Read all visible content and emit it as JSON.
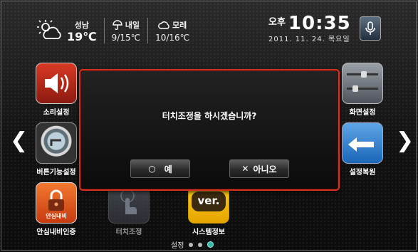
{
  "weather": {
    "today": {
      "city": "성남",
      "temp": "19℃",
      "icon": "partly-cloudy-icon"
    },
    "tomorrow": {
      "label": "내일",
      "temp": "9/15℃",
      "icon": "umbrella-icon"
    },
    "dayafter": {
      "label": "모레",
      "temp": "10/16℃",
      "icon": "cloud-icon"
    }
  },
  "clock": {
    "ampm": "오후",
    "time": "10:35",
    "date": "2011. 11. 24. 목요일"
  },
  "apps": {
    "sound": "소리설정",
    "button": "버튼기능설정",
    "lock": "안심내비인증",
    "lock_badge": "안심내비",
    "touch": "터치조정",
    "version": "시스템정보",
    "version_badge": "ver.",
    "screen": "화면설정",
    "restore": "설정복원"
  },
  "dialog": {
    "message": "터치조정을 하시겠습니까?",
    "yes": "예",
    "no": "아니오"
  },
  "pager": {
    "label": "설정",
    "pages": 3,
    "current": 3
  }
}
